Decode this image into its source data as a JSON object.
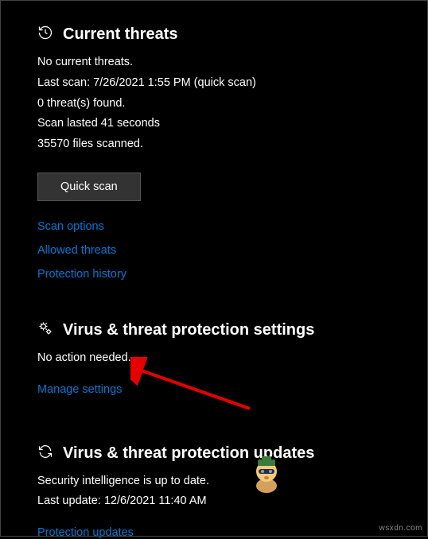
{
  "threats": {
    "title": "Current threats",
    "status": "No current threats.",
    "last_scan": "Last scan: 7/26/2021 1:55 PM (quick scan)",
    "found": "0 threat(s) found.",
    "duration": "Scan lasted 41 seconds",
    "files": "35570 files scanned.",
    "quick_scan_label": "Quick scan",
    "scan_options": "Scan options",
    "allowed_threats": "Allowed threats",
    "protection_history": "Protection history"
  },
  "settings": {
    "title": "Virus & threat protection settings",
    "status": "No action needed.",
    "manage": "Manage settings"
  },
  "updates": {
    "title": "Virus & threat protection updates",
    "status": "Security intelligence is up to date.",
    "last_update": "Last update: 12/6/2021 11:40 AM",
    "protection_updates": "Protection updates"
  },
  "watermark": "wsxdn.com"
}
